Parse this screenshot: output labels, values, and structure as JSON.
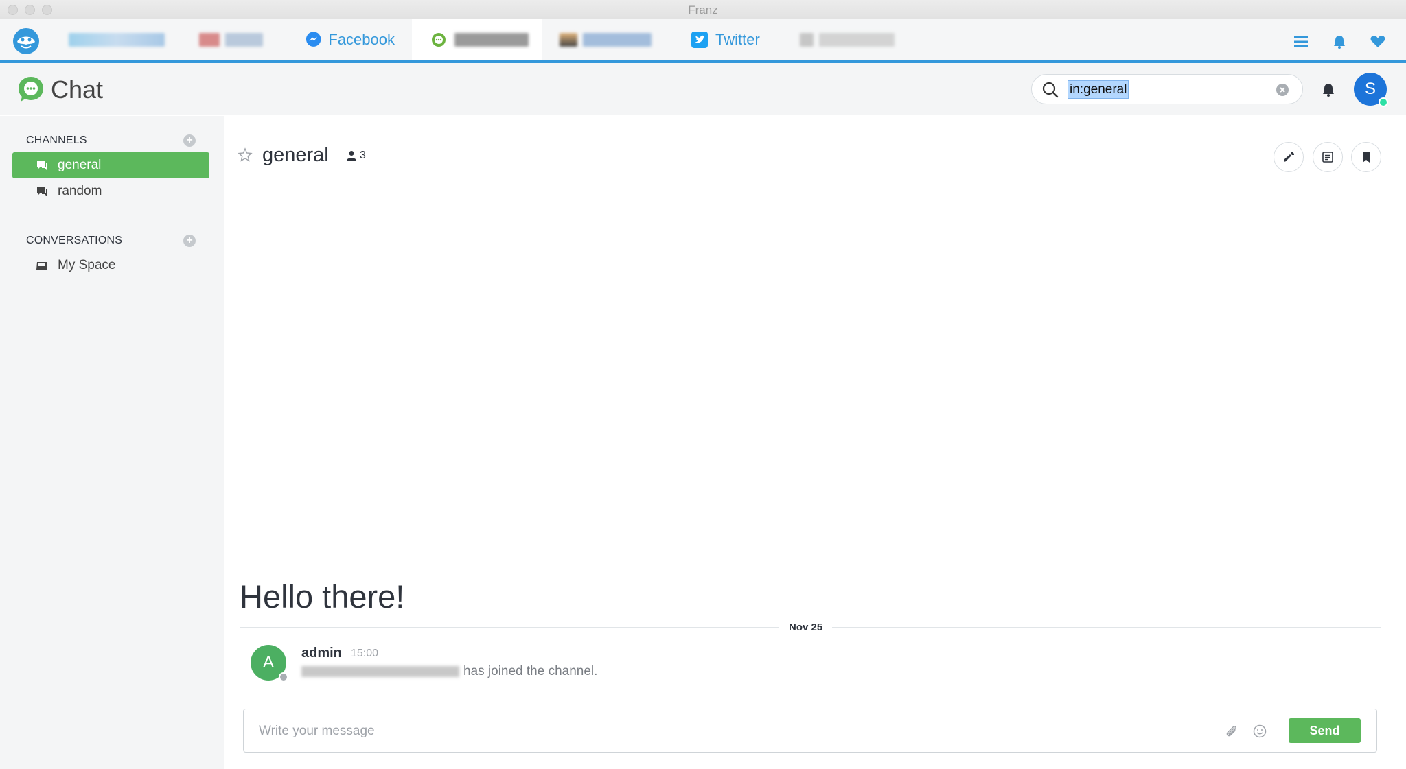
{
  "window": {
    "title": "Franz"
  },
  "tabs": [
    {
      "label": "Facebook",
      "icon": "messenger-icon"
    },
    {
      "label": "Twitter",
      "icon": "twitter-icon"
    }
  ],
  "header": {
    "app_title": "Chat",
    "search_value": "in:general",
    "avatar_initial": "S"
  },
  "sidebar": {
    "channels_heading": "CHANNELS",
    "channels": [
      {
        "label": "general",
        "active": true
      },
      {
        "label": "random",
        "active": false
      }
    ],
    "conversations_heading": "CONVERSATIONS",
    "conversations": [
      {
        "label": "My Space"
      }
    ]
  },
  "room": {
    "name": "general",
    "member_count": "3",
    "welcome": "Hello there!",
    "date_divider": "Nov 25",
    "message": {
      "avatar_initial": "A",
      "user": "admin",
      "time": "15:00",
      "text": "has joined the channel."
    },
    "composer_placeholder": "Write your message",
    "send_label": "Send"
  },
  "colors": {
    "accent_blue": "#3498db",
    "active_green": "#5cb85c",
    "avatar_blue": "#1d74d9"
  }
}
